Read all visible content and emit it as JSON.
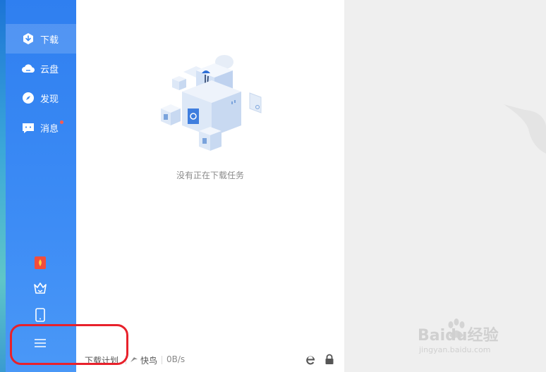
{
  "sidebar": {
    "items": [
      {
        "label": "下载",
        "icon": "download-icon",
        "active": true
      },
      {
        "label": "云盘",
        "icon": "cloud-icon",
        "active": false
      },
      {
        "label": "发现",
        "icon": "compass-icon",
        "active": false
      },
      {
        "label": "消息",
        "icon": "message-icon",
        "active": false,
        "badge": true
      }
    ],
    "bottom_icons": [
      "red-envelope-icon",
      "crown-icon",
      "phone-icon",
      "menu-icon"
    ]
  },
  "main": {
    "empty_message": "没有正在下载任务",
    "illustration": "empty-boxes-illustration"
  },
  "bottom_bar": {
    "plan_label": "下载计划",
    "speed_mode_label": "快鸟",
    "speed": "0B/s",
    "icons": [
      "browser-ie-icon",
      "lock-icon"
    ]
  },
  "watermark": {
    "brand": "Baidu经验",
    "url": "jingyan.baidu.com"
  },
  "colors": {
    "sidebar": "#3d8cf5",
    "highlight": "#e8212b",
    "badge": "#ff5a4e"
  }
}
